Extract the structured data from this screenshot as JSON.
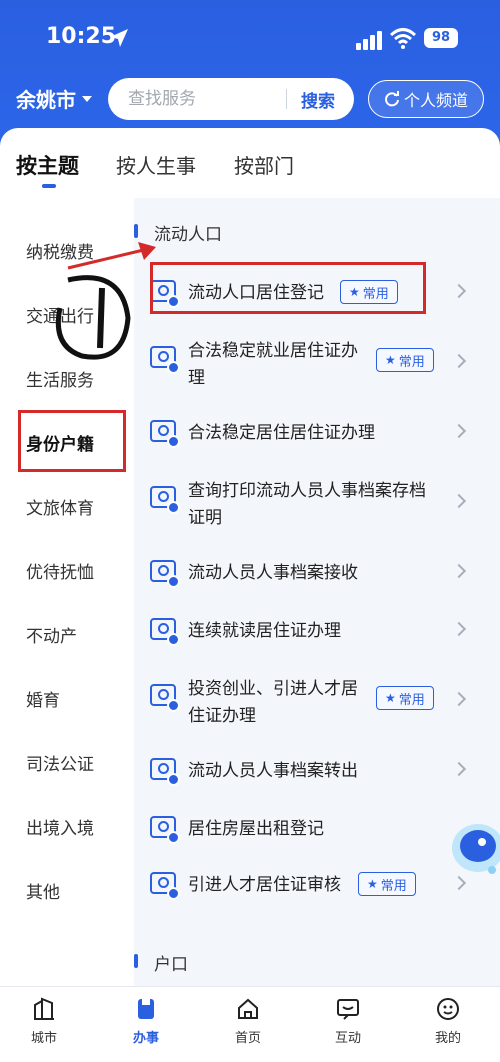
{
  "status_bar": {
    "time": "10:25",
    "battery": "98"
  },
  "header": {
    "city": "余姚市",
    "search_placeholder": "查找服务",
    "search_button": "搜索",
    "channel_button": "个人频道"
  },
  "main_tabs": [
    "按主题",
    "按人生事",
    "按部门"
  ],
  "sidebar": [
    "纳税缴费",
    "交通出行",
    "生活服务",
    "身份户籍",
    "文旅体育",
    "优待抚恤",
    "不动产",
    "婚育",
    "司法公证",
    "出境入境",
    "其他"
  ],
  "sections": [
    {
      "title": "流动人口",
      "services": [
        {
          "label": "流动人口居住登记",
          "badge": "常用"
        },
        {
          "label_line1": "合法稳定就业居住证办",
          "label_line2": "理",
          "badge": "常用"
        },
        {
          "label": "合法稳定居住居住证办理"
        },
        {
          "label_line1": "查询打印流动人员人事档案存档",
          "label_line2": "证明"
        },
        {
          "label": "流动人员人事档案接收"
        },
        {
          "label": "连续就读居住证办理"
        },
        {
          "label_line1": "投资创业、引进人才居",
          "label_line2": "住证办理",
          "badge": "常用"
        },
        {
          "label": "流动人员人事档案转出"
        },
        {
          "label": "居住房屋出租登记"
        },
        {
          "label": "引进人才居住证审核",
          "badge": "常用"
        }
      ]
    },
    {
      "title": "户口"
    }
  ],
  "bottom_nav": [
    "城市",
    "办事",
    "首页",
    "互动",
    "我的"
  ],
  "colors": {
    "primary": "#2a5fe0",
    "annotation": "#d42a2a"
  }
}
